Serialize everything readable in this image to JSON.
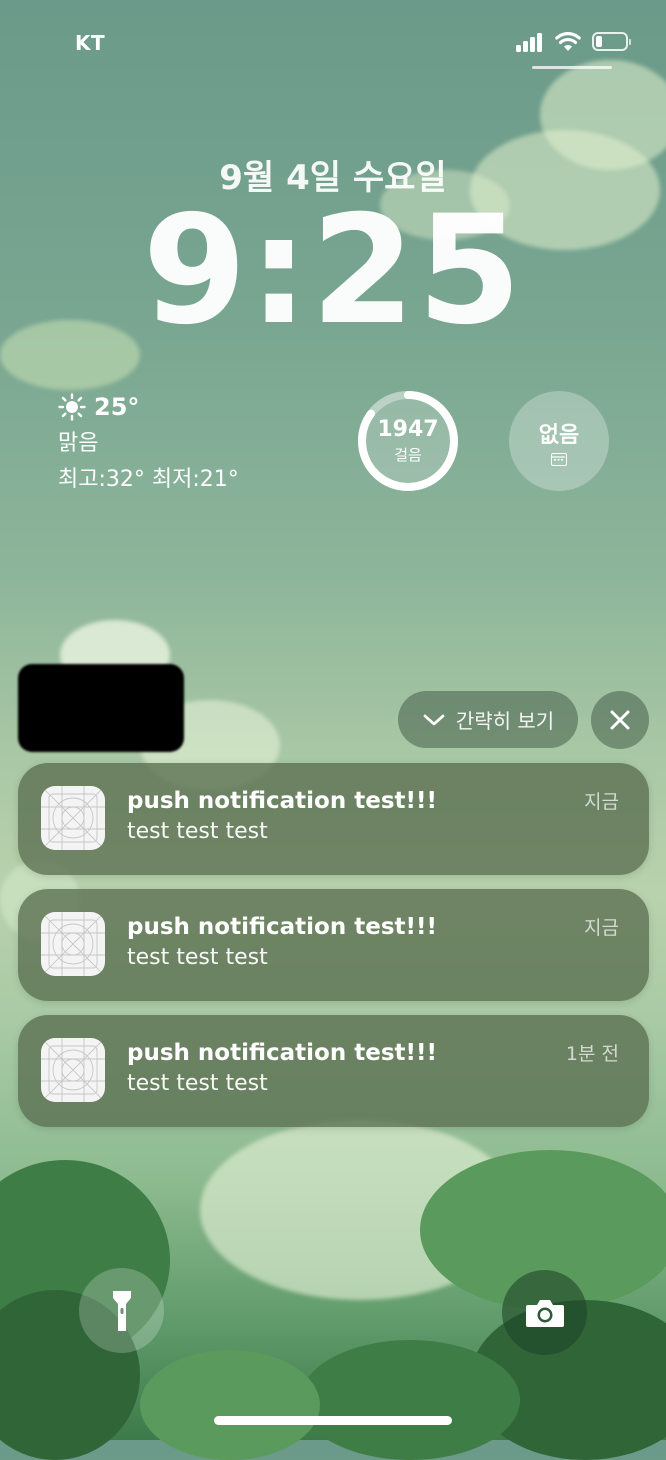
{
  "status_bar": {
    "carrier": "KT",
    "signal_bars": 4,
    "battery_level_percent": 20
  },
  "lock_screen": {
    "date": "9월 4일 수요일",
    "time": "9:25"
  },
  "widgets": {
    "weather": {
      "icon": "sun-icon",
      "temperature": "25°",
      "condition": "맑음",
      "range": "최고:32° 최저:21°"
    },
    "steps": {
      "count": "1947",
      "label": "걸음",
      "ring_progress_percent": 85
    },
    "calendar": {
      "text": "없음",
      "icon": "calendar-icon"
    }
  },
  "notification_controls": {
    "collapse_label": "간략히 보기",
    "collapse_icon": "chevron-down-icon",
    "close_icon": "close-icon"
  },
  "notifications": [
    {
      "title": "push notification test!!!",
      "body": "test test test",
      "time": "지금"
    },
    {
      "title": "push notification test!!!",
      "body": "test test test",
      "time": "지금"
    },
    {
      "title": "push notification test!!!",
      "body": "test test test",
      "time": "1분 전"
    }
  ],
  "quick_actions": {
    "flashlight_icon": "flashlight-icon",
    "camera_icon": "camera-icon"
  }
}
